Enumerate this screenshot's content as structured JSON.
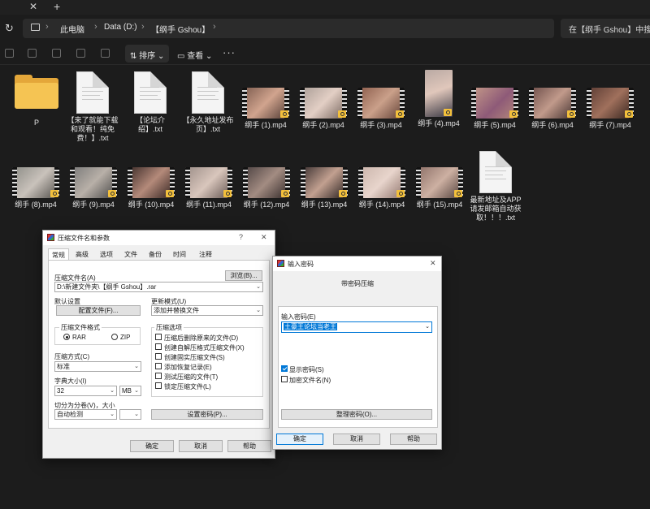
{
  "tabstrip": {
    "close_glyph": "✕",
    "new_tab_glyph": "+"
  },
  "address": {
    "crumbs": [
      "此电脑",
      "Data (D:)",
      "【纲手 Gshou】"
    ],
    "search_placeholder": "在【纲手 Gshou】中搜索"
  },
  "toolbar": {
    "sort_label": "排序",
    "view_label": "查看",
    "more_label": "···"
  },
  "files": {
    "row1": [
      {
        "name": "P",
        "kind": "folder"
      },
      {
        "name": "【来了就能下载和观看！纯免费！】.txt",
        "kind": "doc"
      },
      {
        "name": "【论坛介绍】.txt",
        "kind": "doc"
      },
      {
        "name": "【永久地址发布页】.txt",
        "kind": "doc"
      },
      {
        "name": "纲手 (1).mp4",
        "kind": "video"
      },
      {
        "name": "纲手 (2).mp4",
        "kind": "video"
      },
      {
        "name": "纲手 (3).mp4",
        "kind": "video"
      },
      {
        "name": "纲手 (4).mp4",
        "kind": "video-tall"
      },
      {
        "name": "纲手 (5).mp4",
        "kind": "video"
      },
      {
        "name": "纲手 (6).mp4",
        "kind": "video"
      },
      {
        "name": "纲手 (7).mp4",
        "kind": "video"
      }
    ],
    "row2": [
      {
        "name": "纲手 (8).mp4",
        "kind": "video"
      },
      {
        "name": "纲手 (9).mp4",
        "kind": "video"
      },
      {
        "name": "纲手 (10).mp4",
        "kind": "video"
      },
      {
        "name": "纲手 (11).mp4",
        "kind": "video"
      },
      {
        "name": "纲手 (12).mp4",
        "kind": "video"
      },
      {
        "name": "纲手 (13).mp4",
        "kind": "video"
      },
      {
        "name": "纲手 (14).mp4",
        "kind": "video"
      },
      {
        "name": "纲手 (15).mp4",
        "kind": "video"
      },
      {
        "name": "最新地址及APP请发邮箱自动获取！！！.txt",
        "kind": "doc"
      }
    ]
  },
  "archive_dialog": {
    "title": "压缩文件名和参数",
    "help_glyph": "?",
    "close_glyph": "✕",
    "tabs": [
      "常规",
      "高级",
      "选项",
      "文件",
      "备份",
      "时间",
      "注释"
    ],
    "filename_label": "压缩文件名(A)",
    "browse_button": "浏览(B)...",
    "filename_value": "D:\\新建文件夹\\【纲手 Gshou】.rar",
    "default_settings_label": "默认设置",
    "profiles_button": "配置文件(F)...",
    "update_mode_label": "更新模式(U)",
    "update_mode_value": "添加并替换文件",
    "format_label": "压缩文件格式",
    "format_rar": "RAR",
    "format_zip": "ZIP",
    "options_label": "压缩选项",
    "options": [
      "压缩后删除原来的文件(D)",
      "创建自解压格式压缩文件(X)",
      "创建固实压缩文件(S)",
      "添加恢复记录(E)",
      "测试压缩的文件(T)",
      "锁定压缩文件(L)"
    ],
    "method_label": "压缩方式(C)",
    "method_value": "标准",
    "dict_label": "字典大小(I)",
    "dict_value": "32",
    "dict_unit": "MB",
    "split_label": "切分为分卷(V)，大小",
    "split_value": "自动检测",
    "set_password_button": "设置密码(P)...",
    "ok": "确定",
    "cancel": "取消",
    "help": "帮助"
  },
  "password_dialog": {
    "title": "输入密码",
    "close_glyph": "✕",
    "heading": "带密码压缩",
    "enter_label": "输入密码(E)",
    "password_value": "土豪王论坛当老王",
    "show_password": "显示密码(S)",
    "show_password_checked": true,
    "encrypt_names": "加密文件名(N)",
    "encrypt_names_checked": false,
    "organize_button": "整理密码(O)...",
    "ok": "确定",
    "cancel": "取消",
    "help": "帮助"
  }
}
